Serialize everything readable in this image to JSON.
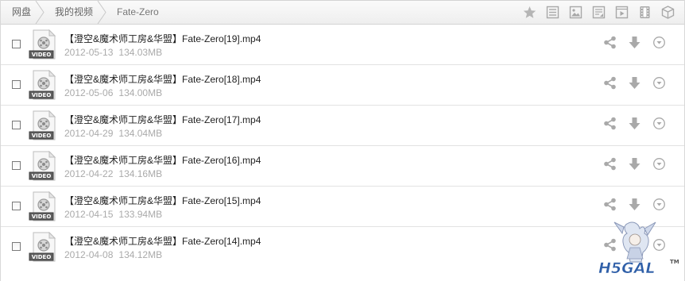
{
  "breadcrumb": [
    "网盘",
    "我的视频",
    "Fate-Zero"
  ],
  "view_icons": [
    "star-icon",
    "list-view-icon",
    "image-view-icon",
    "document-view-icon",
    "video-view-icon",
    "filmstrip-view-icon",
    "box-view-icon"
  ],
  "file_icon_label": "VIDEO",
  "files": [
    {
      "name": "【澄空&魔术师工房&华盟】Fate-Zero[19].mp4",
      "date": "2012-05-13",
      "size": "134.03MB"
    },
    {
      "name": "【澄空&魔术师工房&华盟】Fate-Zero[18].mp4",
      "date": "2012-05-06",
      "size": "134.00MB"
    },
    {
      "name": "【澄空&魔术师工房&华盟】Fate-Zero[17].mp4",
      "date": "2012-04-29",
      "size": "134.04MB"
    },
    {
      "name": "【澄空&魔术师工房&华盟】Fate-Zero[16].mp4",
      "date": "2012-04-22",
      "size": "134.16MB"
    },
    {
      "name": "【澄空&魔术师工房&华盟】Fate-Zero[15].mp4",
      "date": "2012-04-15",
      "size": "133.94MB"
    },
    {
      "name": "【澄空&魔术师工房&华盟】Fate-Zero[14].mp4",
      "date": "2012-04-08",
      "size": "134.12MB"
    }
  ],
  "watermark_text": "H5GAL",
  "watermark_tm": "TM",
  "colors": {
    "icon_gray": "#a9a9a9",
    "meta_gray": "#aaaaaa",
    "border": "#e2e2e2",
    "watermark_blue": "#2f5fa8"
  }
}
